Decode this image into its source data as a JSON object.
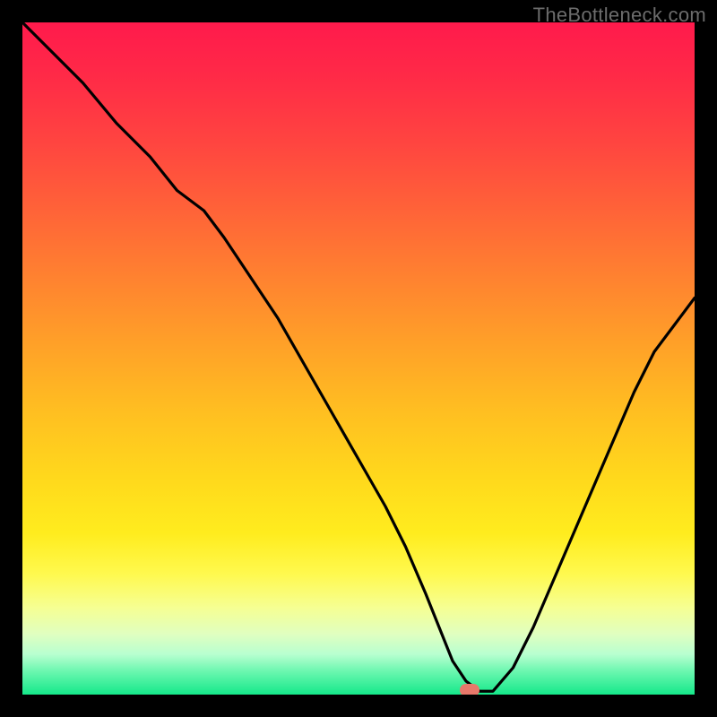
{
  "watermark": "TheBottleneck.com",
  "chart_data": {
    "type": "line",
    "title": "",
    "xlabel": "",
    "ylabel": "",
    "xlim": [
      0,
      100
    ],
    "ylim": [
      0,
      100
    ],
    "legend": false,
    "gradient_stops": [
      {
        "offset": 0.0,
        "color": "#ff1a4c"
      },
      {
        "offset": 0.08,
        "color": "#ff2a47"
      },
      {
        "offset": 0.18,
        "color": "#ff4540"
      },
      {
        "offset": 0.28,
        "color": "#ff6338"
      },
      {
        "offset": 0.38,
        "color": "#ff8230"
      },
      {
        "offset": 0.48,
        "color": "#ffa128"
      },
      {
        "offset": 0.58,
        "color": "#ffbf21"
      },
      {
        "offset": 0.68,
        "color": "#ffd91c"
      },
      {
        "offset": 0.76,
        "color": "#ffec1e"
      },
      {
        "offset": 0.82,
        "color": "#fff94e"
      },
      {
        "offset": 0.87,
        "color": "#f6ff92"
      },
      {
        "offset": 0.91,
        "color": "#e0ffc0"
      },
      {
        "offset": 0.94,
        "color": "#b8ffd0"
      },
      {
        "offset": 0.965,
        "color": "#6cf7b0"
      },
      {
        "offset": 1.0,
        "color": "#15e88a"
      }
    ],
    "curve": {
      "x": [
        0,
        4,
        9,
        14,
        19,
        23,
        27,
        30,
        34,
        38,
        42,
        46,
        50,
        54,
        57,
        60,
        62,
        64,
        66,
        68,
        70,
        73,
        76,
        79,
        82,
        85,
        88,
        91,
        94,
        97,
        100
      ],
      "y": [
        100,
        96,
        91,
        85,
        80,
        75,
        72,
        68,
        62,
        56,
        49,
        42,
        35,
        28,
        22,
        15,
        10,
        5,
        2,
        0.5,
        0.5,
        4,
        10,
        17,
        24,
        31,
        38,
        45,
        51,
        55,
        59
      ]
    },
    "marker": {
      "x": 66.5,
      "y": 0.7,
      "color": "#e8786a"
    }
  }
}
